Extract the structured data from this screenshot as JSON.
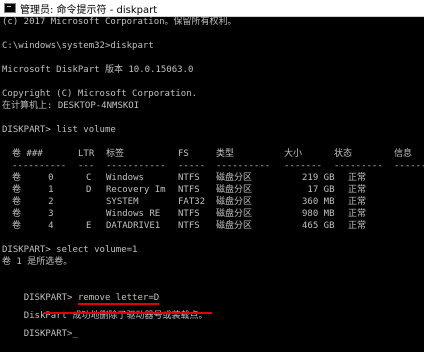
{
  "window": {
    "icon": "cmd-icon",
    "title": "管理员: 命令提示符 - diskpart"
  },
  "console": {
    "banner1": "(c) 2017 Microsoft Corporation。保留所有权利。",
    "prompt_diskpart": "C:\\windows\\system32>diskpart",
    "version": "Microsoft DiskPart 版本 10.0.15063.0",
    "copyright": "Copyright (C) Microsoft Corporation.",
    "computer": "在计算机上: DESKTOP-4NMSKOI",
    "cmd_list": "DISKPART> list volume",
    "headers": [
      "卷 ###",
      "LTR",
      "标签",
      "FS",
      "类型",
      "大小",
      "状态",
      "信息"
    ],
    "dashes": [
      "----------",
      "---",
      "-----------",
      "-----",
      "----------",
      "-------",
      "---------",
      "--------"
    ],
    "volumes": [
      {
        "num": "卷     0",
        "ltr": "C",
        "label": "Windows",
        "fs": "NTFS",
        "type": "磁盘分区",
        "size": "219 GB",
        "status": "正常"
      },
      {
        "num": "卷     1",
        "ltr": "D",
        "label": "Recovery Im",
        "fs": "NTFS",
        "type": "磁盘分区",
        "size": " 17 GB",
        "status": "正常"
      },
      {
        "num": "卷     2",
        "ltr": "",
        "label": "SYSTEM",
        "fs": "FAT32",
        "type": "磁盘分区",
        "size": "360 MB",
        "status": "正常"
      },
      {
        "num": "卷     3",
        "ltr": "",
        "label": "Windows RE",
        "fs": "NTFS",
        "type": "磁盘分区",
        "size": "980 MB",
        "status": "正常"
      },
      {
        "num": "卷     4",
        "ltr": "E",
        "label": "DATADRIVE1",
        "fs": "NTFS",
        "type": "磁盘分区",
        "size": "465 GB",
        "status": "正常"
      }
    ],
    "cmd_select": "DISKPART> select volume=1",
    "select_result": "卷 1 是所选卷。",
    "prompt_remove": "DISKPART> ",
    "cmd_remove": "remove letter=D",
    "result_prefix": "DiskPart ",
    "result_text": "成功地删除了驱动器号或装载点。",
    "final_prompt": "DISKPART>",
    "cursor": "_"
  },
  "colors": {
    "background": "#000000",
    "text": "#c0c0c0",
    "annotation": "#e00000"
  }
}
